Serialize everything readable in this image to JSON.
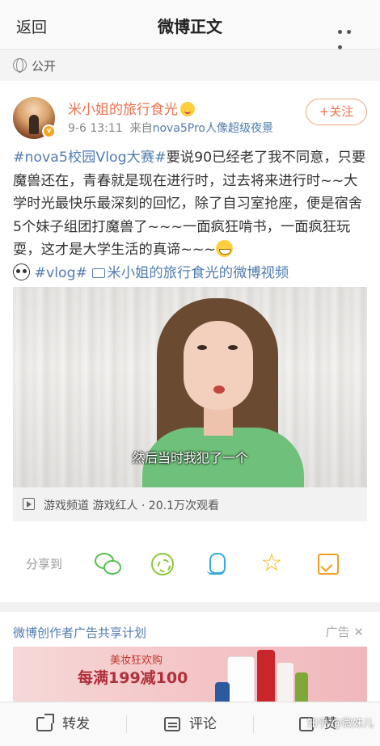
{
  "header": {
    "back_label": "返回",
    "title": "微博正文",
    "more_icon": "more-dots-icon"
  },
  "visibility": {
    "icon": "globe-icon",
    "label": "公开"
  },
  "post": {
    "author": "米小姐的旅行食光",
    "time": "9-6 13:11",
    "source_prefix": "来自",
    "source": "nova5Pro人像超级夜景",
    "follow_label": "+关注",
    "hashtag": "#nova5校园Vlog大赛#",
    "body": "要说90已经老了我不同意，只要魔兽还在，青春就是现在进行时，过去将来进行时~~大学时光最快乐最深刻的回忆，除了自习室抢座，便是宿舍5个妹子组团打魔兽了~~~一面疯狂啃书，一面疯狂玩耍，这才是大学生活的真谛~~~",
    "hashtag2": "#vlog#",
    "video_link": "米小姐的旅行食光的微博视频"
  },
  "video": {
    "subtitle": "然后当时我犯了一个",
    "info": "游戏频道 游戏红人 · 20.1万次观看"
  },
  "share": {
    "label": "分享到",
    "targets": [
      "wechat-icon",
      "moments-icon",
      "qq-icon",
      "qzone-icon",
      "album-icon"
    ]
  },
  "ad": {
    "header": "微博创作者广告共享计划",
    "label": "广告",
    "banner_line1": "美妆狂欢购",
    "banner_line2": "每满199减100"
  },
  "bottom_bar": {
    "repost": "转发",
    "comment": "评论",
    "like": "赞"
  },
  "watermark": "知乎 @微妹儿",
  "colors": {
    "accent_orange": "#eb7350",
    "link_blue": "#507daf"
  }
}
